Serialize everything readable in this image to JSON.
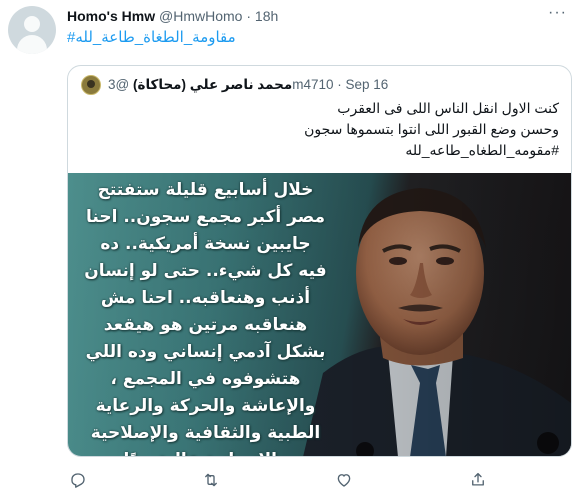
{
  "tweet": {
    "display_name": "Homo's Hmw",
    "handle": "@HmwHomo",
    "separator": "·",
    "time": "18h",
    "more_icon": "more-horizontal-icon",
    "text": "#مقاومة_الطغاة_طاعة_لله"
  },
  "quoted": {
    "display_name": "محمد ناصر علي (محاكاة)",
    "handle": "@3m4710",
    "separator": "·",
    "date": "Sep 16",
    "lines": [
      "كنت الاول انقل الناس اللى فى العقرب",
      "وحسن وضع القبور اللى انتوا بتسموها سجون",
      "#مقومه_الطغاه_طاعه_لله"
    ],
    "image_text": [
      "خلال أسابيع قليلة ستفتتح",
      "مصر أكبر مجمع سجون.. احنا",
      "جايبين نسخة أمريكية.. ده",
      "فيه كل شيء.. حتى لو إنسان",
      "أذنب وهنعاقبه.. احنا مش",
      "هنعاقبه مرتين هو هيقعد",
      "بشكل آدمي إنساني وده اللي",
      "هتشوفوه في المجمع ،",
      "والإعاشة والحركة والرعاية",
      "الطبية والثقافية والإصلاحية",
      "والإنسانية عالية جدًا"
    ]
  },
  "actions": {
    "reply_icon": "reply-icon",
    "retweet_icon": "retweet-icon",
    "like_icon": "like-icon",
    "share_icon": "share-icon"
  },
  "colors": {
    "accent": "#1d9bf0",
    "muted": "#536471",
    "border": "#cfd9de"
  }
}
